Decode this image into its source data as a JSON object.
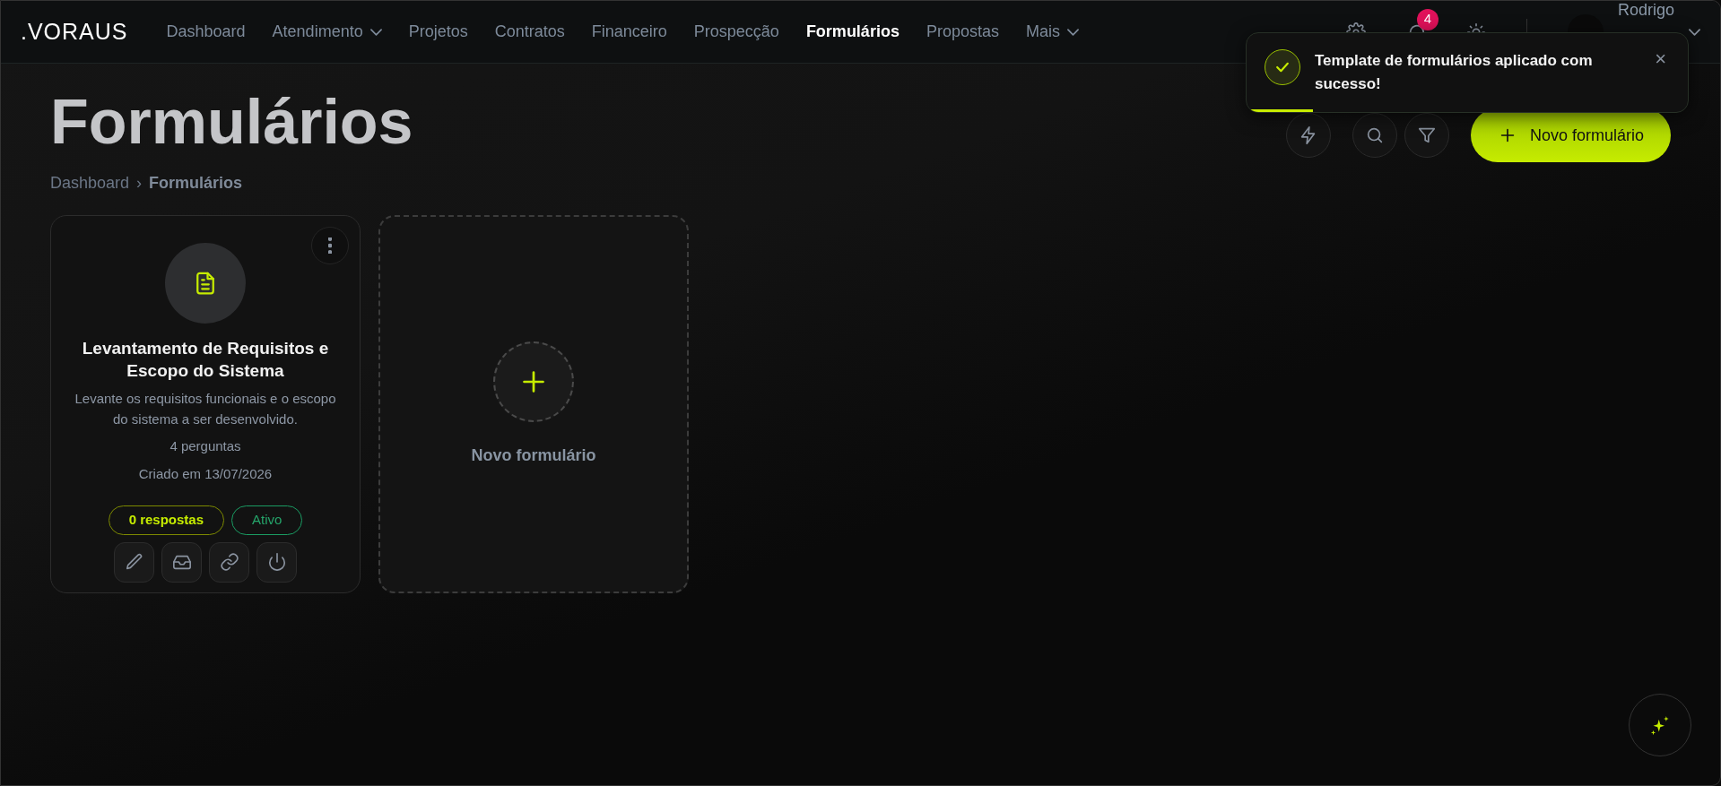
{
  "navbar": {
    "logo": ".VORAUS",
    "items": [
      {
        "label": "Dashboard",
        "selected": false,
        "has_menu": false
      },
      {
        "label": "Atendimento",
        "selected": false,
        "has_menu": true
      },
      {
        "label": "Projetos",
        "selected": false,
        "has_menu": false
      },
      {
        "label": "Contratos",
        "selected": false,
        "has_menu": false
      },
      {
        "label": "Financeiro",
        "selected": false,
        "has_menu": false
      },
      {
        "label": "Prospecção",
        "selected": false,
        "has_menu": false
      },
      {
        "label": "Formulários",
        "selected": true,
        "has_menu": false
      },
      {
        "label": "Propostas",
        "selected": false,
        "has_menu": false
      },
      {
        "label": "Mais",
        "selected": false,
        "has_menu": true
      }
    ],
    "notification_count": "4",
    "user": {
      "name": "Rodrigo"
    }
  },
  "toast": {
    "message": "Template de formulários aplicado com sucesso!",
    "close": "×",
    "level": 0.15
  },
  "header": {
    "title": "Formulários",
    "breadcrumb": [
      {
        "label": "Dashboard",
        "current": false
      },
      {
        "label": "Formulários",
        "current": true
      }
    ],
    "separator": "›",
    "new_button": "Novo formulário"
  },
  "forms": [
    {
      "title": "Levantamento de Requisitos e Escopo do Sistema",
      "description": "Levante os requisitos funcionais e o escopo do sistema a ser desenvolvido.",
      "questions": "4 perguntas",
      "created": "Criado em 13/07/2026",
      "responses": "0 respostas",
      "status": "Ativo",
      "active": true
    }
  ],
  "new_card": {
    "label": "Novo formulário"
  }
}
